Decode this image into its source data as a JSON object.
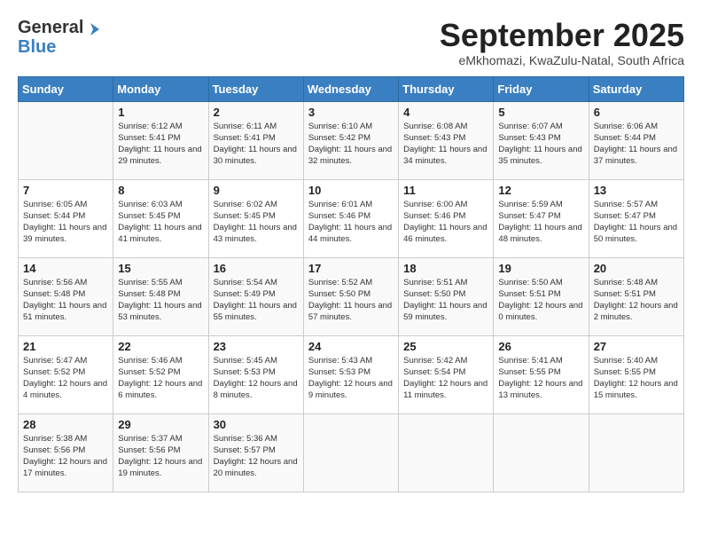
{
  "logo": {
    "general": "General",
    "blue": "Blue"
  },
  "title": "September 2025",
  "subtitle": "eMkhomazi, KwaZulu-Natal, South Africa",
  "days_of_week": [
    "Sunday",
    "Monday",
    "Tuesday",
    "Wednesday",
    "Thursday",
    "Friday",
    "Saturday"
  ],
  "weeks": [
    [
      {
        "day": "",
        "sunrise": "",
        "sunset": "",
        "daylight": ""
      },
      {
        "day": "1",
        "sunrise": "Sunrise: 6:12 AM",
        "sunset": "Sunset: 5:41 PM",
        "daylight": "Daylight: 11 hours and 29 minutes."
      },
      {
        "day": "2",
        "sunrise": "Sunrise: 6:11 AM",
        "sunset": "Sunset: 5:41 PM",
        "daylight": "Daylight: 11 hours and 30 minutes."
      },
      {
        "day": "3",
        "sunrise": "Sunrise: 6:10 AM",
        "sunset": "Sunset: 5:42 PM",
        "daylight": "Daylight: 11 hours and 32 minutes."
      },
      {
        "day": "4",
        "sunrise": "Sunrise: 6:08 AM",
        "sunset": "Sunset: 5:43 PM",
        "daylight": "Daylight: 11 hours and 34 minutes."
      },
      {
        "day": "5",
        "sunrise": "Sunrise: 6:07 AM",
        "sunset": "Sunset: 5:43 PM",
        "daylight": "Daylight: 11 hours and 35 minutes."
      },
      {
        "day": "6",
        "sunrise": "Sunrise: 6:06 AM",
        "sunset": "Sunset: 5:44 PM",
        "daylight": "Daylight: 11 hours and 37 minutes."
      }
    ],
    [
      {
        "day": "7",
        "sunrise": "Sunrise: 6:05 AM",
        "sunset": "Sunset: 5:44 PM",
        "daylight": "Daylight: 11 hours and 39 minutes."
      },
      {
        "day": "8",
        "sunrise": "Sunrise: 6:03 AM",
        "sunset": "Sunset: 5:45 PM",
        "daylight": "Daylight: 11 hours and 41 minutes."
      },
      {
        "day": "9",
        "sunrise": "Sunrise: 6:02 AM",
        "sunset": "Sunset: 5:45 PM",
        "daylight": "Daylight: 11 hours and 43 minutes."
      },
      {
        "day": "10",
        "sunrise": "Sunrise: 6:01 AM",
        "sunset": "Sunset: 5:46 PM",
        "daylight": "Daylight: 11 hours and 44 minutes."
      },
      {
        "day": "11",
        "sunrise": "Sunrise: 6:00 AM",
        "sunset": "Sunset: 5:46 PM",
        "daylight": "Daylight: 11 hours and 46 minutes."
      },
      {
        "day": "12",
        "sunrise": "Sunrise: 5:59 AM",
        "sunset": "Sunset: 5:47 PM",
        "daylight": "Daylight: 11 hours and 48 minutes."
      },
      {
        "day": "13",
        "sunrise": "Sunrise: 5:57 AM",
        "sunset": "Sunset: 5:47 PM",
        "daylight": "Daylight: 11 hours and 50 minutes."
      }
    ],
    [
      {
        "day": "14",
        "sunrise": "Sunrise: 5:56 AM",
        "sunset": "Sunset: 5:48 PM",
        "daylight": "Daylight: 11 hours and 51 minutes."
      },
      {
        "day": "15",
        "sunrise": "Sunrise: 5:55 AM",
        "sunset": "Sunset: 5:48 PM",
        "daylight": "Daylight: 11 hours and 53 minutes."
      },
      {
        "day": "16",
        "sunrise": "Sunrise: 5:54 AM",
        "sunset": "Sunset: 5:49 PM",
        "daylight": "Daylight: 11 hours and 55 minutes."
      },
      {
        "day": "17",
        "sunrise": "Sunrise: 5:52 AM",
        "sunset": "Sunset: 5:50 PM",
        "daylight": "Daylight: 11 hours and 57 minutes."
      },
      {
        "day": "18",
        "sunrise": "Sunrise: 5:51 AM",
        "sunset": "Sunset: 5:50 PM",
        "daylight": "Daylight: 11 hours and 59 minutes."
      },
      {
        "day": "19",
        "sunrise": "Sunrise: 5:50 AM",
        "sunset": "Sunset: 5:51 PM",
        "daylight": "Daylight: 12 hours and 0 minutes."
      },
      {
        "day": "20",
        "sunrise": "Sunrise: 5:48 AM",
        "sunset": "Sunset: 5:51 PM",
        "daylight": "Daylight: 12 hours and 2 minutes."
      }
    ],
    [
      {
        "day": "21",
        "sunrise": "Sunrise: 5:47 AM",
        "sunset": "Sunset: 5:52 PM",
        "daylight": "Daylight: 12 hours and 4 minutes."
      },
      {
        "day": "22",
        "sunrise": "Sunrise: 5:46 AM",
        "sunset": "Sunset: 5:52 PM",
        "daylight": "Daylight: 12 hours and 6 minutes."
      },
      {
        "day": "23",
        "sunrise": "Sunrise: 5:45 AM",
        "sunset": "Sunset: 5:53 PM",
        "daylight": "Daylight: 12 hours and 8 minutes."
      },
      {
        "day": "24",
        "sunrise": "Sunrise: 5:43 AM",
        "sunset": "Sunset: 5:53 PM",
        "daylight": "Daylight: 12 hours and 9 minutes."
      },
      {
        "day": "25",
        "sunrise": "Sunrise: 5:42 AM",
        "sunset": "Sunset: 5:54 PM",
        "daylight": "Daylight: 12 hours and 11 minutes."
      },
      {
        "day": "26",
        "sunrise": "Sunrise: 5:41 AM",
        "sunset": "Sunset: 5:55 PM",
        "daylight": "Daylight: 12 hours and 13 minutes."
      },
      {
        "day": "27",
        "sunrise": "Sunrise: 5:40 AM",
        "sunset": "Sunset: 5:55 PM",
        "daylight": "Daylight: 12 hours and 15 minutes."
      }
    ],
    [
      {
        "day": "28",
        "sunrise": "Sunrise: 5:38 AM",
        "sunset": "Sunset: 5:56 PM",
        "daylight": "Daylight: 12 hours and 17 minutes."
      },
      {
        "day": "29",
        "sunrise": "Sunrise: 5:37 AM",
        "sunset": "Sunset: 5:56 PM",
        "daylight": "Daylight: 12 hours and 19 minutes."
      },
      {
        "day": "30",
        "sunrise": "Sunrise: 5:36 AM",
        "sunset": "Sunset: 5:57 PM",
        "daylight": "Daylight: 12 hours and 20 minutes."
      },
      {
        "day": "",
        "sunrise": "",
        "sunset": "",
        "daylight": ""
      },
      {
        "day": "",
        "sunrise": "",
        "sunset": "",
        "daylight": ""
      },
      {
        "day": "",
        "sunrise": "",
        "sunset": "",
        "daylight": ""
      },
      {
        "day": "",
        "sunrise": "",
        "sunset": "",
        "daylight": ""
      }
    ]
  ]
}
